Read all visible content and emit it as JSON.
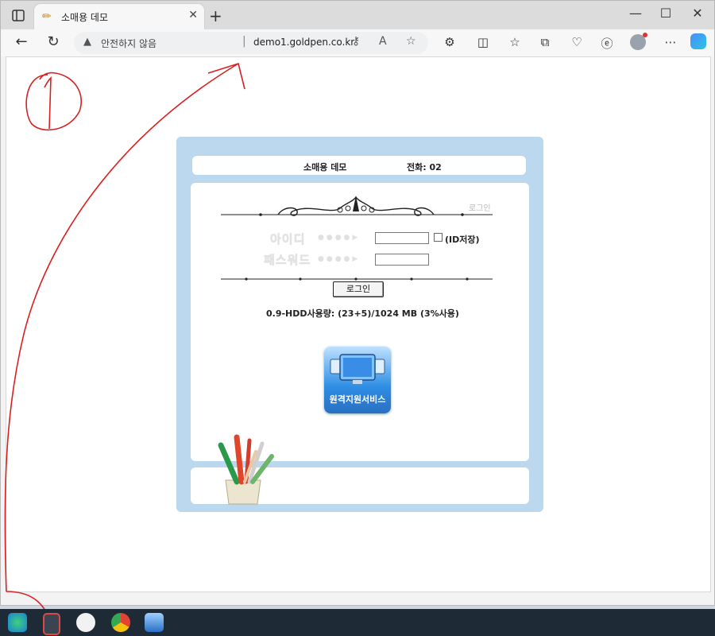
{
  "browser": {
    "tab_title": "소매용 데모",
    "security_text": "안전하지 않음",
    "url": "demo1.goldpen.co.kr"
  },
  "page": {
    "company_name": "소매용 데모",
    "phone": "전화: 02",
    "login_caption": "로그인",
    "id_label": "아이디",
    "password_label": "패스워드",
    "save_id_label": "(ID저장)",
    "login_button": "로그인",
    "hdd_usage": "0.9-HDD사용량: (23+5)/1024 MB (3%사용)",
    "remote_support_label": "원격지원서비스"
  },
  "annotation": {
    "marker": "①",
    "color": "#d92020"
  },
  "taskbar": {
    "apps": [
      "edge-icon",
      "calculator-icon",
      "keyboard-icon",
      "chrome-icon",
      "remote-app-icon"
    ]
  }
}
